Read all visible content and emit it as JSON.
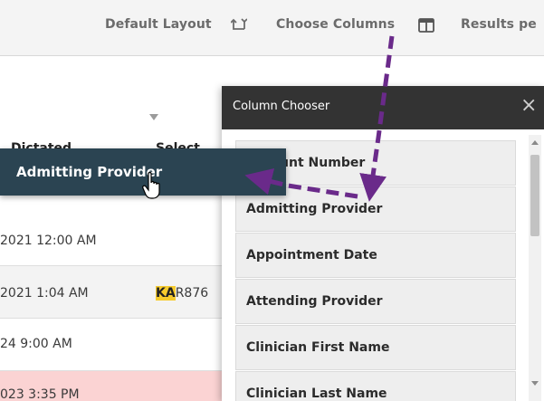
{
  "toolbar": {
    "default_layout": "Default Layout",
    "choose_columns": "Choose Columns",
    "results_per_page": "Results pe"
  },
  "grid": {
    "col_headers": [
      "Dictated",
      "Select"
    ],
    "rows": [
      {
        "date": "2021 12:00 AM",
        "extra": ""
      },
      {
        "date": "2021 1:04 AM",
        "extra_hl": "KA",
        "extra": "R876"
      },
      {
        "date": "24 9:00 AM",
        "extra": ""
      },
      {
        "date": "023 3:35 PM",
        "extra": ""
      }
    ]
  },
  "chooser": {
    "title": "Column Chooser",
    "close": "×",
    "items": [
      "Account Number",
      "Admitting Provider",
      "Appointment Date",
      "Attending Provider",
      "Clinician First Name",
      "Clinician Last Name"
    ]
  },
  "drag_pill": {
    "label": "Admitting Provider"
  },
  "colors": {
    "annotation_arrow": "#6a2a8a",
    "drag_pill_bg": "#2b4452",
    "chooser_title_bg": "#333333",
    "highlight": "#f6cb2d",
    "row_alt": "#f3f3f3",
    "row_error": "#fbd3d3"
  }
}
